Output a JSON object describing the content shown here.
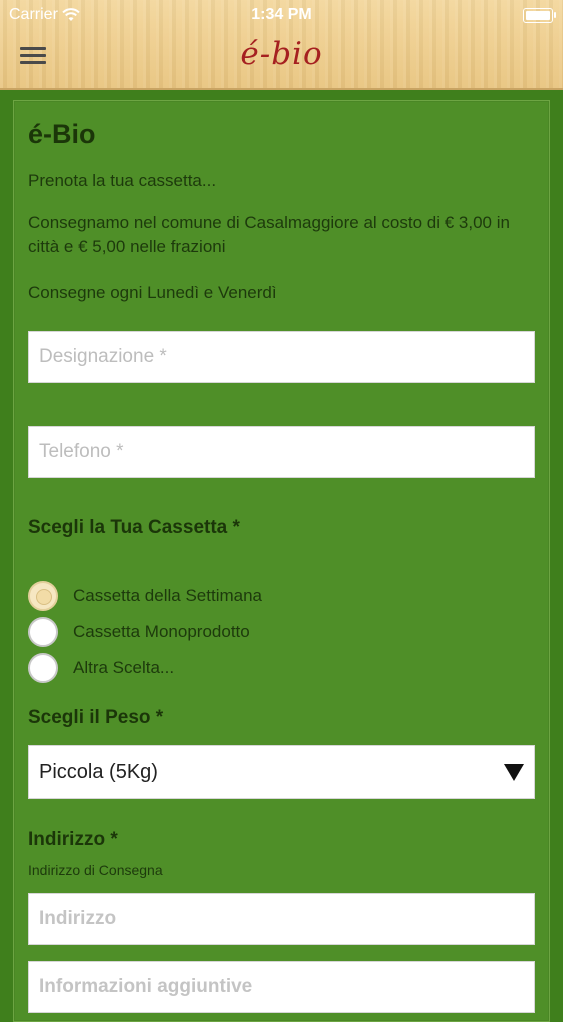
{
  "status_bar": {
    "carrier": "Carrier",
    "time": "1:34 PM",
    "battery_level": 1.0,
    "wifi_icon": "wifi-icon"
  },
  "header": {
    "logo": "é-bio",
    "menu_icon": "hamburger-menu-icon"
  },
  "form": {
    "title": "é-Bio",
    "intro": "Prenota la tua cassetta...",
    "delivery_info": "Consegnamo nel comune di Casalmaggiore al costo di € 3,00 in città e € 5,00 nelle frazioni",
    "delivery_days": "Consegne ogni Lunedì e Venerdì",
    "designazione_placeholder": "Designazione *",
    "telefono_placeholder": "Telefono *",
    "cassetta_label": "Scegli la Tua Cassetta *",
    "cassetta_options": [
      {
        "label": "Cassetta della Settimana",
        "selected": true
      },
      {
        "label": "Cassetta Monoprodotto",
        "selected": false
      },
      {
        "label": "Altra Scelta...",
        "selected": false
      }
    ],
    "peso_label": "Scegli il Peso *",
    "peso_value": "Piccola (5Kg)",
    "indirizzo_label": "Indirizzo *",
    "indirizzo_hint": "Indirizzo di Consegna",
    "indirizzo_placeholder": "Indirizzo",
    "info_placeholder": "Informazioni aggiuntive"
  },
  "colors": {
    "background": "#3f7f1c",
    "panel": "#4f8f28",
    "logo": "#a52020",
    "text_dark_green": "#1b3609"
  }
}
